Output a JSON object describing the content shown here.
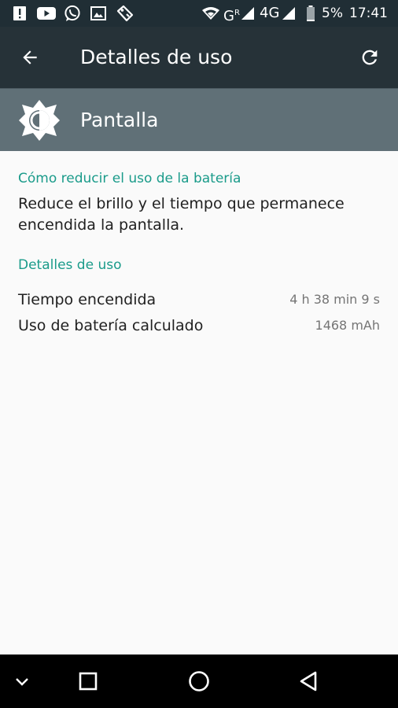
{
  "status_bar": {
    "battery_percent": "5%",
    "time": "17:41",
    "network": "4G",
    "signal_label": "G",
    "signal_sup": "R",
    "icons": [
      "alert-icon",
      "youtube-icon",
      "whatsapp-icon",
      "image-icon",
      "tag-icon",
      "wifi-icon",
      "signal-icon",
      "battery-icon"
    ]
  },
  "app_bar": {
    "title": "Detalles de uso",
    "back_icon": "arrow-back-icon",
    "refresh_icon": "refresh-icon"
  },
  "item_header": {
    "icon": "brightness-icon",
    "label": "Pantalla"
  },
  "tips": {
    "title": "Cómo reducir el uso de la batería",
    "text": "Reduce el brillo y el tiempo que permanece encendida la pantalla."
  },
  "usage": {
    "title": "Detalles de uso",
    "rows": [
      {
        "label": "Tiempo encendida",
        "value": "4 h 38 min 9 s"
      },
      {
        "label": "Uso de batería calculado",
        "value": "1468 mAh"
      }
    ]
  },
  "nav_bar": {
    "icons": [
      "chevron-down-icon",
      "recents-icon",
      "home-icon",
      "back-triangle-icon"
    ]
  },
  "colors": {
    "status_bar": "#202e35",
    "app_bar": "#263238",
    "header": "#607077",
    "accent": "#1a9b8a",
    "background": "#fafafa"
  }
}
